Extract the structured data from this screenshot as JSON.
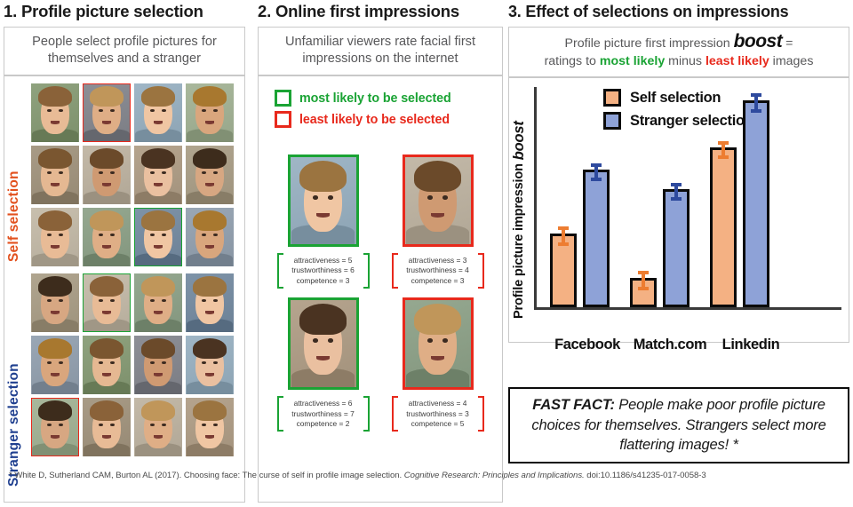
{
  "panel1": {
    "title": "1. Profile picture selection",
    "caption": "People select profile pictures for themselves and a stranger",
    "label_self": "Self selection",
    "label_stranger": "Stranger selection",
    "self_grid": {
      "rows": 3,
      "cols": 4,
      "most_likely_cell": "row3-col3",
      "least_likely_cell": "row1-col2"
    },
    "stranger_grid": {
      "rows": 3,
      "cols": 4,
      "most_likely_cell": "row1-col2",
      "least_likely_cell": "row3-col1"
    }
  },
  "panel2": {
    "title": "2. Online first impressions",
    "caption": "Unfamiliar viewers rate facial first impressions on the internet",
    "legend": [
      {
        "key": "most",
        "label": "most likely to be selected",
        "color": "#1aa334"
      },
      {
        "key": "least",
        "label": "least likely to be selected",
        "color": "#e8291c"
      }
    ],
    "examples": [
      {
        "row": 1,
        "most": {
          "attractiveness": "attractiveness = 5",
          "trustworthiness": "trustworthiness = 6",
          "competence": "competence = 3"
        },
        "least": {
          "attractiveness": "attractiveness = 3",
          "trustworthiness": "trustworthiness = 4",
          "competence": "competence = 3"
        }
      },
      {
        "row": 2,
        "most": {
          "attractiveness": "attractiveness = 6",
          "trustworthiness": "trustworthiness = 7",
          "competence": "competence = 2"
        },
        "least": {
          "attractiveness": "attractiveness = 4",
          "trustworthiness": "trustworthiness = 3",
          "competence": "competence = 5"
        }
      }
    ]
  },
  "panel3": {
    "title": "3. Effect of selections on impressions",
    "caption_line1_a": "Profile picture first impression ",
    "caption_boost": "boost",
    "caption_line1_b": " =",
    "caption_line2_a": "ratings to ",
    "caption_most": "most likely",
    "caption_line2_b": " minus ",
    "caption_least": "least likely",
    "caption_line2_c": " images"
  },
  "chart_data": {
    "type": "bar",
    "title": "",
    "xlabel": "",
    "ylabel": "Profile picture impression boost",
    "categories": [
      "Facebook",
      "Match.com",
      "Linkedin"
    ],
    "series": [
      {
        "name": "Self selection",
        "color": "#f4b183",
        "error_color": "#ed7d31",
        "values": [
          0.33,
          0.13,
          0.72
        ],
        "errors": [
          0.045,
          0.045,
          0.04
        ]
      },
      {
        "name": "Stranger selection",
        "color": "#8ea2d7",
        "error_color": "#2e4a9e",
        "values": [
          0.62,
          0.53,
          0.93
        ],
        "errors": [
          0.04,
          0.04,
          0.045
        ]
      }
    ],
    "ylim": [
      0,
      1
    ],
    "grid": false,
    "legend_position": "top-left",
    "axis_ticks_shown": false
  },
  "fast_fact": {
    "label": "FAST FACT:",
    "text": " People make poor profile picture choices for themselves. Strangers select more flattering images! *"
  },
  "footnote": {
    "prefix": "* White D, Sutherland CAM, Burton AL (2017). Choosing face: The curse of self in profile image selection. ",
    "journal": "Cognitive Research: Principles and Implications.",
    "doi": " doi:10.1186/s41235-017-0058-3"
  },
  "colors": {
    "green": "#1aa334",
    "red": "#e8291c",
    "self_orange": "#f4b183",
    "stranger_blue": "#8ea2d7",
    "self_label": "#e2511e",
    "stranger_label": "#1f3f8f"
  }
}
